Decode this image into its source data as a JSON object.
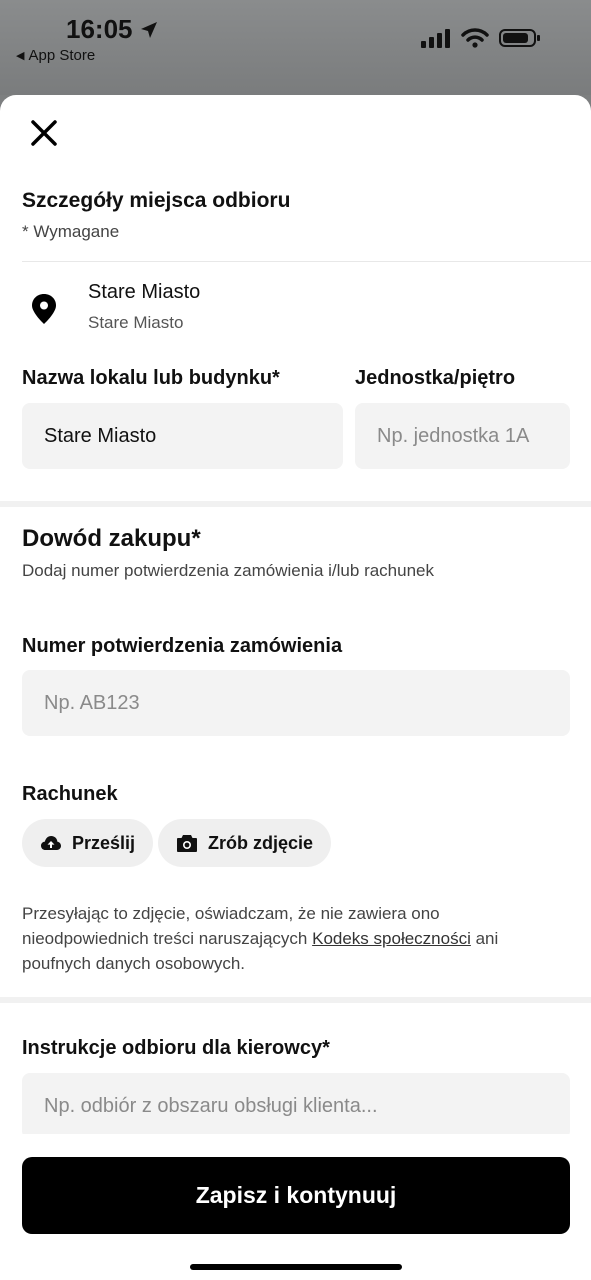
{
  "status_bar": {
    "time": "16:05",
    "back_label": "App Store"
  },
  "header": {
    "title": "Szczegóły miejsca odbioru",
    "required_note": "* Wymagane"
  },
  "location": {
    "name": "Stare Miasto",
    "subtitle": "Stare Miasto"
  },
  "building_field": {
    "label": "Nazwa lokalu lub budynku*",
    "value": "Stare Miasto"
  },
  "unit_field": {
    "label": "Jednostka/piętro",
    "placeholder": "Np. jednostka 1A"
  },
  "proof": {
    "title": "Dowód zakupu*",
    "description": "Dodaj numer potwierdzenia zamówienia i/lub rachunek"
  },
  "order_number_field": {
    "label": "Numer potwierdzenia zamówienia",
    "placeholder": "Np. AB123"
  },
  "receipt": {
    "label": "Rachunek",
    "upload_label": "Prześlij",
    "photo_label": "Zrób zdjęcie"
  },
  "disclaimer": {
    "part1": "Przesyłając to zdjęcie, oświadczam, że nie zawiera ono nieodpowiednich treści naruszających ",
    "link": "Kodeks społeczności",
    "part2": " ani poufnych danych osobowych."
  },
  "instructions_field": {
    "label": "Instrukcje odbioru dla kierowcy*",
    "placeholder": "Np. odbiór z obszaru obsługi klienta..."
  },
  "footer": {
    "save_label": "Zapisz i kontynuuj"
  },
  "icons": {
    "close": "close-icon",
    "location": "location-pin-icon",
    "upload": "cloud-upload-icon",
    "camera": "camera-icon"
  }
}
